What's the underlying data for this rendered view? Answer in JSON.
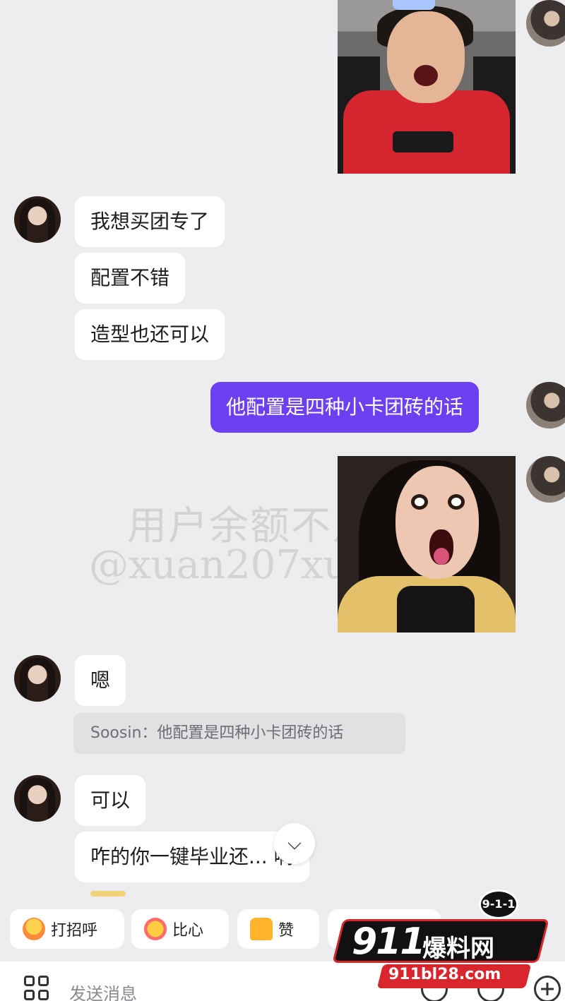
{
  "messages": {
    "m1": "我想买团专了",
    "m2": "配置不错",
    "m3": "造型也还可以",
    "m4_out": "他配置是四种小卡团砖的话",
    "m5": "嗯",
    "m6": "可以",
    "m7": "咋的你一键毕业还... 啊"
  },
  "quote_reply": "Soosin：他配置是四种小卡团砖的话",
  "watermark": {
    "line1": "用户余额不足",
    "line2": "@xuan207xuan"
  },
  "quick_actions": [
    "打招呼",
    "比心",
    "赞"
  ],
  "input": {
    "placeholder": "发送消息"
  },
  "logo": {
    "number": "911",
    "name": "爆料网",
    "url": "911bl28.com",
    "badge": "9-1-1"
  },
  "colors": {
    "outgoing_bubble": "#6c3ff0",
    "background": "#ededef"
  },
  "icons": [
    "grid-apps-icon",
    "emoji-icon",
    "plus-icon",
    "scroll-down-icon"
  ]
}
